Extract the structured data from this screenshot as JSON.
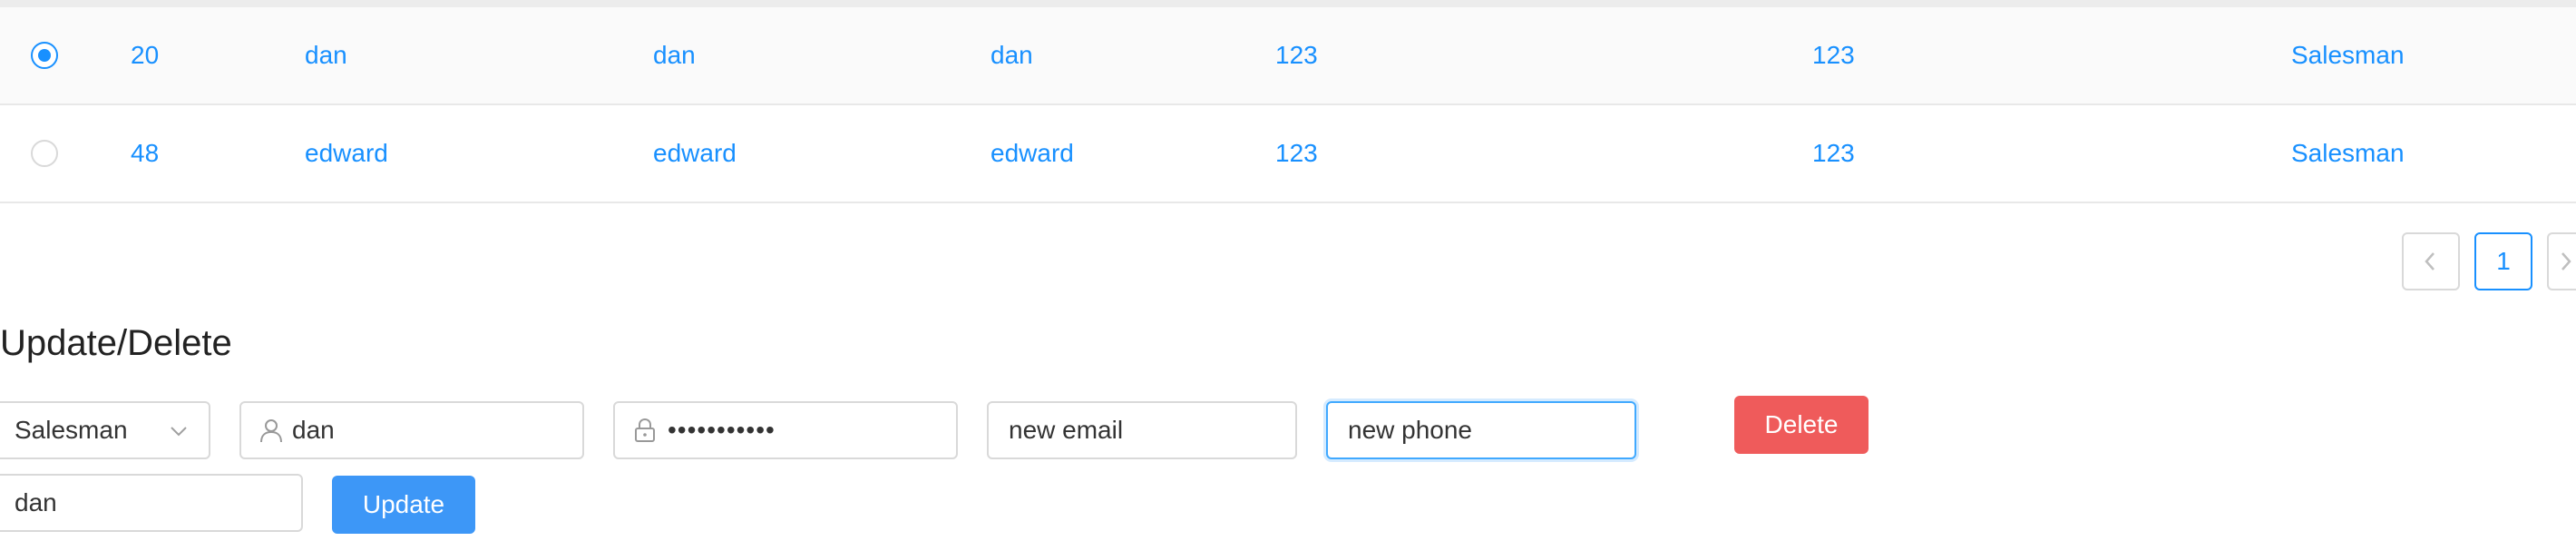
{
  "table": {
    "rows": [
      {
        "selected": true,
        "id": "20",
        "c1": "dan",
        "c2": "dan",
        "c3": "dan",
        "c4": "123",
        "c5": "123",
        "role": "Salesman"
      },
      {
        "selected": false,
        "id": "48",
        "c1": "edward",
        "c2": "edward",
        "c3": "edward",
        "c4": "123",
        "c5": "123",
        "role": "Salesman"
      }
    ]
  },
  "pagination": {
    "current_page": "1"
  },
  "form": {
    "heading": "Update/Delete",
    "role_select": {
      "value": "Salesman"
    },
    "username": {
      "value": "dan"
    },
    "password": {
      "value": "•••••••••••"
    },
    "email": {
      "placeholder": "new email"
    },
    "phone": {
      "placeholder": "new phone"
    },
    "name": {
      "value": "dan"
    },
    "delete_label": "Delete",
    "update_label": "Update"
  },
  "icons": {
    "user": "user-icon",
    "lock": "lock-icon",
    "chevron_down": "chevron-down-icon",
    "chevron_left": "chevron-left-icon",
    "chevron_right": "chevron-right-icon"
  },
  "colors": {
    "accent": "#1890ff",
    "delete": "#ef5b5b",
    "update": "#3d97f7",
    "row_selected_bg": "#fafafa"
  }
}
